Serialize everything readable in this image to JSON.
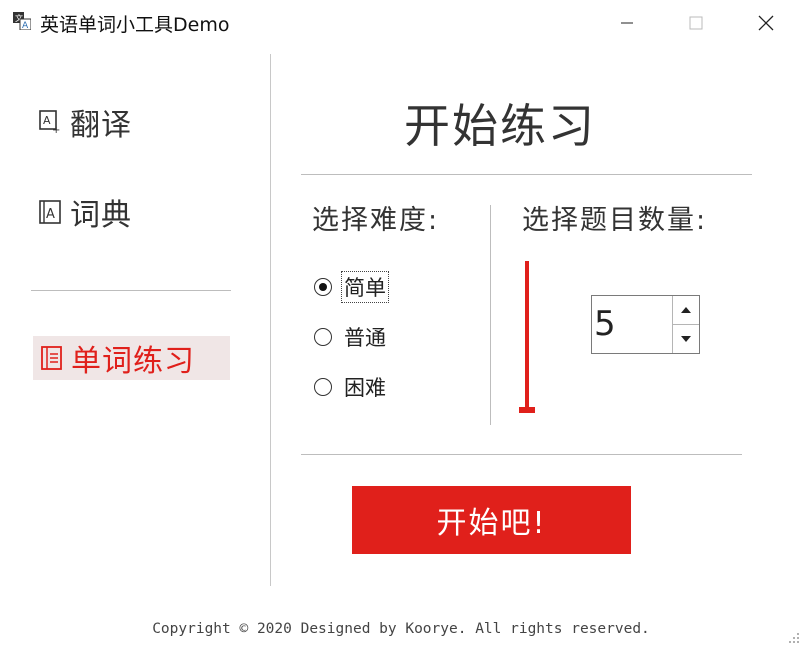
{
  "window": {
    "title": "英语单词小工具Demo",
    "icons": {
      "app": "app-icon",
      "minimize": "minimize-icon",
      "maximize": "maximize-icon",
      "close": "close-icon"
    }
  },
  "sidebar": {
    "items": [
      {
        "label": "翻译",
        "icon": "translate-icon"
      },
      {
        "label": "词典",
        "icon": "dictionary-icon"
      },
      {
        "label": "单词练习",
        "icon": "list-icon",
        "selected": true
      }
    ]
  },
  "main": {
    "heading": "开始练习",
    "difficulty": {
      "label": "选择难度:",
      "options": [
        "简单",
        "普通",
        "困难"
      ],
      "selected": "简单"
    },
    "count": {
      "label": "选择题目数量:",
      "value": "5",
      "slider_level": 0
    },
    "start_button": "开始吧!"
  },
  "footer": "Copyright © 2020 Designed by Kooryе. All rights reserved.",
  "colors": {
    "accent": "#e0201b",
    "selected_bg": "#f0e6e6",
    "text": "#333333"
  }
}
